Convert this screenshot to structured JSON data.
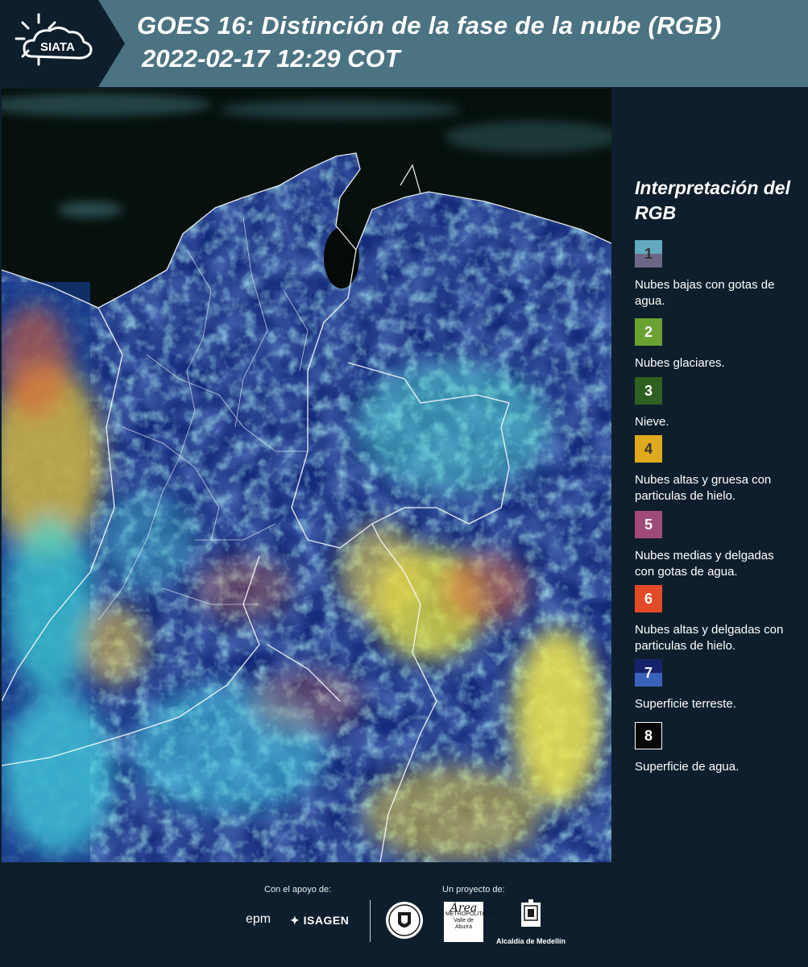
{
  "header": {
    "logo_text": "SIATA",
    "title_line1": "GOES 16: Distinción de la fase de la nube (RGB)",
    "title_line2": "2022-02-17 12:29 COT"
  },
  "legend": {
    "title": "Interpretación del RGB",
    "items": [
      {
        "number": "1",
        "text": "Nubes bajas con gotas de agua.",
        "color_top": "#62a9bd",
        "color_bottom": "#6e6785",
        "num_color": "#333333"
      },
      {
        "number": "2",
        "text": "Nubes glaciares.",
        "color_top": "#6aa232",
        "color_bottom": "#6aa232",
        "num_color": "#ffffff"
      },
      {
        "number": "3",
        "text": "Nieve.",
        "color_top": "#2f6020",
        "color_bottom": "#2f6020",
        "num_color": "#ffffff"
      },
      {
        "number": "4",
        "text": "Nubes altas y gruesa con particulas de hielo.",
        "color_top": "#e0aa1e",
        "color_bottom": "#e0aa1e",
        "num_color": "#333333"
      },
      {
        "number": "5",
        "text": "Nubes medias y delgadas con gotas de agua.",
        "color_top": "#a04a7b",
        "color_bottom": "#a04a7b",
        "num_color": "#ffffff"
      },
      {
        "number": "6",
        "text": "Nubes altas y delgadas con particulas de hielo.",
        "color_top": "#e24a28",
        "color_bottom": "#e24a28",
        "num_color": "#ffffff"
      },
      {
        "number": "7",
        "text": "Superficie terreste.",
        "color_top": "#16226a",
        "color_bottom": "#3a62b8",
        "num_color": "#ffffff"
      },
      {
        "number": "8",
        "text": "Superficie de agua.",
        "color_top": "#050805",
        "color_bottom": "#050805",
        "num_color": "#ffffff"
      }
    ]
  },
  "footer": {
    "support_label": "Con el apoyo de:",
    "project_label": "Un proyecto de:",
    "epm": "epm",
    "isagen": "ISAGEN",
    "amva_big": "Área",
    "amva_small": "METROPOLITANA",
    "amva_sub": "Valle de Aburrá",
    "medellin": "Alcaldía de Medellín"
  },
  "colors": {
    "header_bg": "#4b7382",
    "logo_bg": "#0e1e2c",
    "page_bg": "#0e1e2c"
  }
}
